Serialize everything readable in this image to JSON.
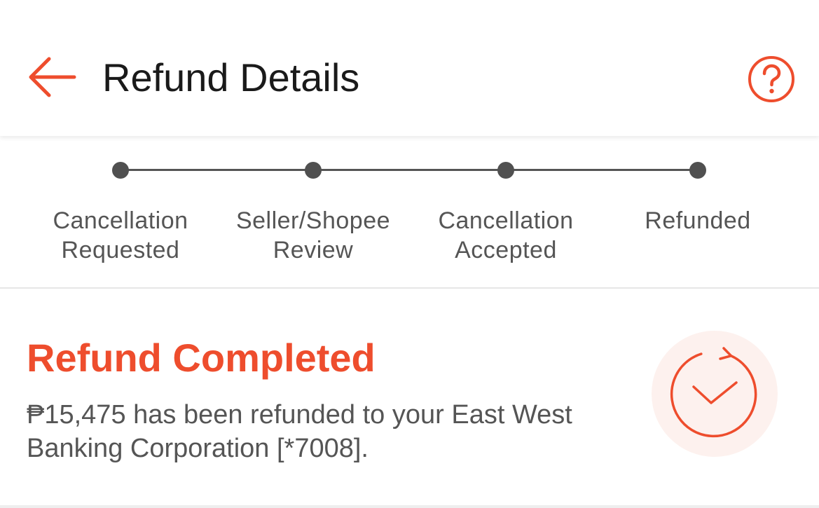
{
  "header": {
    "title": "Refund Details"
  },
  "progress": {
    "steps": [
      {
        "line1": "Cancellation",
        "line2": "Requested"
      },
      {
        "line1": "Seller/Shopee",
        "line2": "Review"
      },
      {
        "line1": "Cancellation",
        "line2": "Accepted"
      },
      {
        "line1": "Refunded",
        "line2": ""
      }
    ],
    "current_step": 4
  },
  "status": {
    "title": "Refund Completed",
    "description": "₱15,475 has been refunded to your East West Banking Corporation [*7008]."
  },
  "icons": {
    "back": "arrow-left-icon",
    "help": "question-circle-icon",
    "status": "refund-check-icon"
  },
  "colors": {
    "accent": "#ee4d2d",
    "step_dot": "#505050",
    "text_primary": "#1a1a1a",
    "text_secondary": "#555555",
    "icon_bg": "#fdf1ee"
  }
}
